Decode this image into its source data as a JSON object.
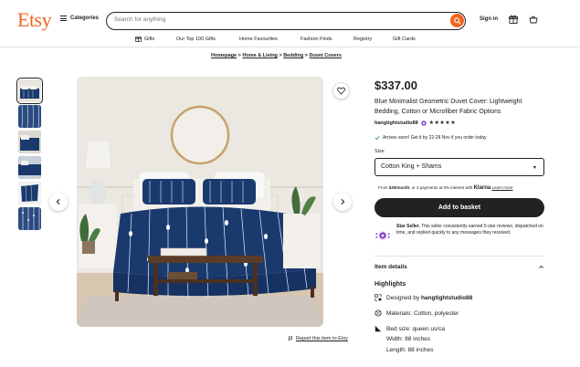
{
  "header": {
    "logo": "Etsy",
    "categories_label": "Categories",
    "search_placeholder": "Search for anything",
    "signin_label": "Sign in"
  },
  "nav": {
    "items": [
      "Gifts",
      "Our Top 100 Gifts",
      "Home Favourites",
      "Fashion Finds",
      "Registry",
      "Gift Cards"
    ]
  },
  "breadcrumb": {
    "items": [
      "Homepage",
      "Home & Living",
      "Bedding",
      "Duvet Covers"
    ],
    "separator": ">"
  },
  "product": {
    "price": "$337.00",
    "title": "Blue Minimalist Geometric Duvet Cover: Lightweight Bedding, Cotton or Microfiber Fabric Options",
    "shop_name": "hangtightstudio88",
    "stars": "★★★★★",
    "arrival": "Arrives soon! Get it by 22-28 Nov if you order today",
    "size_label": "Size",
    "size_value": "Cotton King + Shams",
    "klarna_prefix": "From ",
    "klarna_amount": "$30/month",
    "klarna_middle": ", or 4 payments at 0% interest with ",
    "klarna_brand": "Klarna",
    "klarna_link": "Learn more",
    "add_to_basket": "Add to basket",
    "star_seller_title": "Star Seller.",
    "star_seller_text": " This seller consistently earned 5-star reviews, dispatched on time, and replied quickly to any messages they received.",
    "item_details_label": "Item details",
    "highlights_label": "Highlights",
    "designed_by_prefix": "Designed by ",
    "designed_by": "hangtightstudio88",
    "materials": "Materials: Cotton, polyester",
    "bed_size": "Bed size: queen us/ca",
    "width": "Width: 88 inches",
    "length": "Length: 88 inches"
  },
  "report_link": "Report this item to Etsy",
  "colors": {
    "brand": "#F1641E",
    "duvet_navy": "#1a3a6e",
    "button_dark": "#222222",
    "star_seller_purple": "#7F35C6"
  }
}
